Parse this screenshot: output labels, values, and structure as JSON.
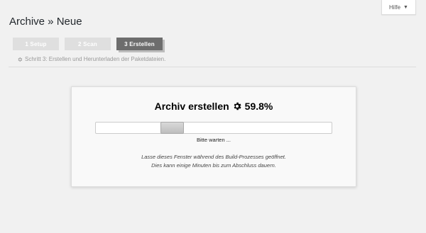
{
  "page": {
    "title": "Archive » Neue"
  },
  "help": {
    "label": "Hilfe",
    "caret": "▼"
  },
  "steps": [
    {
      "label": "1 Setup",
      "state": "done"
    },
    {
      "label": "2 Scan",
      "state": "done"
    },
    {
      "label": "3 Erstellen",
      "state": "active"
    }
  ],
  "step_description": {
    "icon": "gear-icon",
    "text": "Schritt 3: Erstellen und Herunterladen der Paketdateien."
  },
  "build": {
    "title": "Archiv erstellen",
    "icon": "gear-icon",
    "percent_text": "59.8%",
    "progress_fraction": 0.598,
    "status": "Bitte warten ...",
    "note_line1": "Lasse dieses Fenster während des Build-Prozesses geöffnet.",
    "note_line2": "Dies kann einige Minuten bis zum Abschluss dauern."
  },
  "colors": {
    "background": "#f1f1f1",
    "step_inactive": "#dfdfdf",
    "step_active": "#6d6d6d"
  }
}
